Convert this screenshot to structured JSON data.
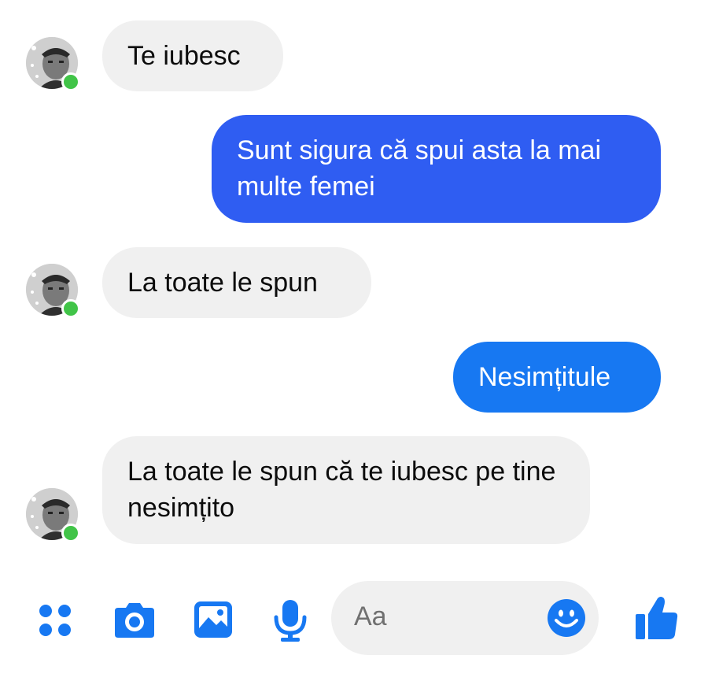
{
  "messages": [
    {
      "from": "other",
      "text": "Te iubesc"
    },
    {
      "from": "me",
      "text": "Sunt sigura că spui asta la mai multe femei"
    },
    {
      "from": "other",
      "text": "La toate le spun"
    },
    {
      "from": "me",
      "text": "Nesimțitule"
    },
    {
      "from": "other",
      "text": "La toate le spun că te iubesc pe tine nesimțito"
    }
  ],
  "composer": {
    "placeholder": "Aa",
    "icons": [
      "more-apps-icon",
      "camera-icon",
      "gallery-icon",
      "microphone-icon",
      "emoji-icon",
      "thumbs-up-icon"
    ]
  },
  "colors": {
    "outgoing_dark": "#2f5df2",
    "outgoing_light": "#1778f2",
    "incoming": "#f0f0f0",
    "online": "#41c448",
    "accent": "#1778f2"
  }
}
